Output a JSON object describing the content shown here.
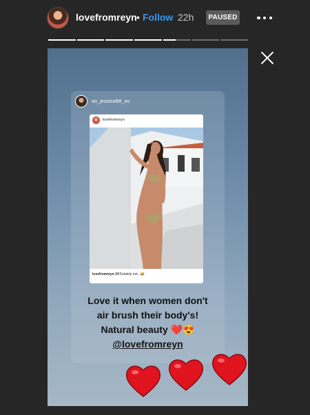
{
  "header": {
    "username": "lovefromreyn",
    "separator": "•",
    "follow_label": "Follow",
    "time_ago": "22h",
    "status_badge": "PAUSED"
  },
  "progress": {
    "segments_total": 7,
    "segments_complete": 4,
    "current_segment_progress": 0.45
  },
  "story": {
    "shared_post": {
      "sharer_username": "xo_jessica98_xo",
      "original_username": "lovefromreyn",
      "caption_user": "lovefromreyn",
      "caption_text": "ABSolutely not...😂"
    },
    "text_lines": [
      "Love it when women don't",
      "air brush their body's!",
      "Natural beauty ❤️😍"
    ],
    "mention": "@lovefromreyn"
  },
  "colors": {
    "background": "#262626",
    "accent": "#3897f0",
    "heart": "#e0141e"
  },
  "icons": [
    "more-options-icon",
    "close-icon",
    "heart-icon"
  ]
}
